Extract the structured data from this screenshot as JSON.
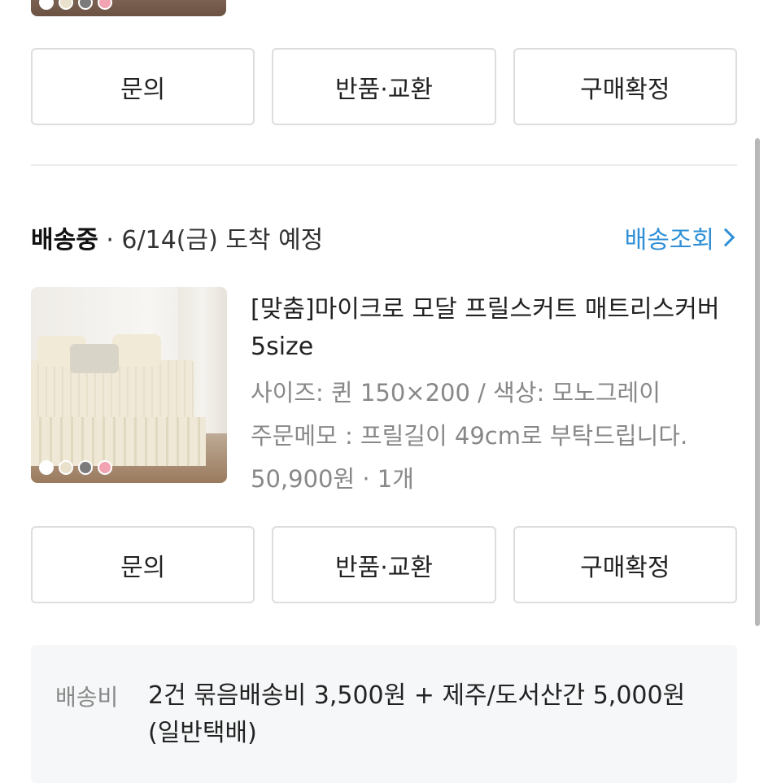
{
  "top_item": {
    "swatch_colors": [
      "#ffffff",
      "#e9e1cc",
      "#7b7b7b",
      "#f2a3b2"
    ]
  },
  "top_actions": {
    "inquiry_label": "문의",
    "return_exchange_label": "반품·교환",
    "confirm_purchase_label": "구매확정"
  },
  "shipment": {
    "status": "배송중",
    "separator": " · ",
    "eta": "6/14(금) 도착 예정",
    "track_label": "배송조회"
  },
  "product": {
    "title": "[맞춤]마이크로 모달 프릴스커트 매트리스커버 5size",
    "option": "사이즈: 퀸 150×200 / 색상: 모노그레이",
    "memo": "주문메모 : 프릴길이 49cm로 부탁드립니다.",
    "price_qty": "50,900원 · 1개",
    "swatch_colors": [
      "#ffffff",
      "#e9e1cc",
      "#7b7b7b",
      "#f2a3b2"
    ]
  },
  "bottom_actions": {
    "inquiry_label": "문의",
    "return_exchange_label": "반품·교환",
    "confirm_purchase_label": "구매확정"
  },
  "shipping_fee": {
    "label": "배송비",
    "value": "2건 묶음배송비 3,500원 + 제주/도서산간 5,000원 (일반택배)"
  },
  "colors": {
    "link": "#2f8fd6",
    "border": "#dddddd",
    "fee_background": "#f6f7f8"
  }
}
